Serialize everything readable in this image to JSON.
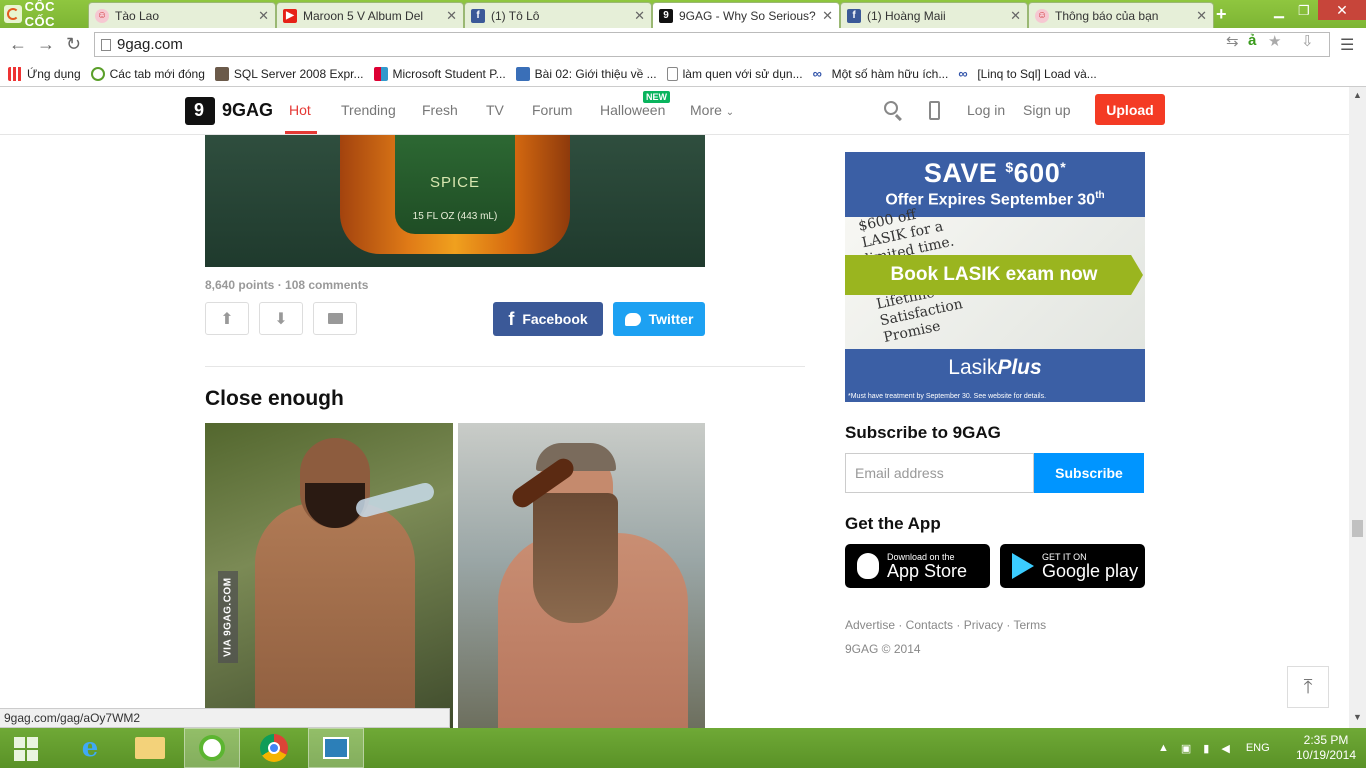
{
  "browser": {
    "brand": "CỐC CỐC",
    "tabs": [
      {
        "title": "Tào Lao",
        "icon": "smile-icon"
      },
      {
        "title": "Maroon 5 V Album Del",
        "icon": "youtube-icon"
      },
      {
        "title": "(1) Tô Lô",
        "icon": "facebook-icon"
      },
      {
        "title": "9GAG - Why So Serious?",
        "icon": "9gag-icon",
        "active": true
      },
      {
        "title": "(1) Hoàng Maii",
        "icon": "facebook-icon"
      },
      {
        "title": "Thông báo của bạn",
        "icon": "smile-icon"
      }
    ],
    "url": "9gag.com",
    "bookmarks": [
      {
        "label": "Ứng dụng",
        "icon": "apps-icon"
      },
      {
        "label": "Các tab mới đóng",
        "icon": "history-icon"
      },
      {
        "label": "SQL Server 2008 Expr...",
        "icon": "sql-icon"
      },
      {
        "label": "Microsoft Student P...",
        "icon": "microsoft-icon"
      },
      {
        "label": "Bài 02: Giới thiệu về ...",
        "icon": "site-icon"
      },
      {
        "label": "làm quen với sử dụn...",
        "icon": "page-icon"
      },
      {
        "label": "Một số hàm hữu ích...",
        "icon": "link-icon"
      },
      {
        "label": "[Linq to Sql] Load và...",
        "icon": "link-icon"
      }
    ],
    "status_url": "9gag.com/gag/aOy7WM2"
  },
  "site": {
    "logo": "9GAG",
    "nav": [
      {
        "label": "Hot",
        "active": true
      },
      {
        "label": "Trending"
      },
      {
        "label": "Fresh"
      },
      {
        "label": "TV"
      },
      {
        "label": "Forum"
      },
      {
        "label": "Halloween",
        "badge": "NEW"
      },
      {
        "label": "More"
      }
    ],
    "login": "Log in",
    "signup": "Sign up",
    "upload": "Upload"
  },
  "post1": {
    "bottle_text": "SPICE",
    "bottle_volume": "15 FL OZ (443 mL)",
    "meta": "8,640 points · 108 comments",
    "facebook": "Facebook",
    "twitter": "Twitter"
  },
  "post2": {
    "title": "Close enough",
    "watermark": "VIA 9GAG.COM"
  },
  "ad": {
    "save_prefix": "SAVE",
    "save_currency": "$",
    "save_amount": "600",
    "save_mark": "*",
    "expires": "Offer Expires September 30",
    "expires_suffix": "th",
    "note_lines": [
      "$600 off",
      "LASIK for a",
      "limited time."
    ],
    "note_lines2": [
      "Lifetime",
      "Satisfaction",
      "Promise"
    ],
    "cta": "Book LASIK exam now",
    "brand_prefix": "Lasik",
    "brand_bold": "Plus",
    "disclaimer": "*Must have treatment by September 30. See website for details."
  },
  "sidebar": {
    "subscribe_title": "Subscribe to 9GAG",
    "email_placeholder": "Email address",
    "subscribe_button": "Subscribe",
    "app_title": "Get the App",
    "appstore_small": "Download on the",
    "appstore_big": "App Store",
    "googleplay_small": "GET IT ON",
    "googleplay_big": "Google play",
    "footer_links": "Advertise · Contacts · Privacy · Terms",
    "copyright": "9GAG © 2014"
  },
  "taskbar": {
    "language": "ENG",
    "time": "2:35 PM",
    "date": "10/19/2014"
  }
}
